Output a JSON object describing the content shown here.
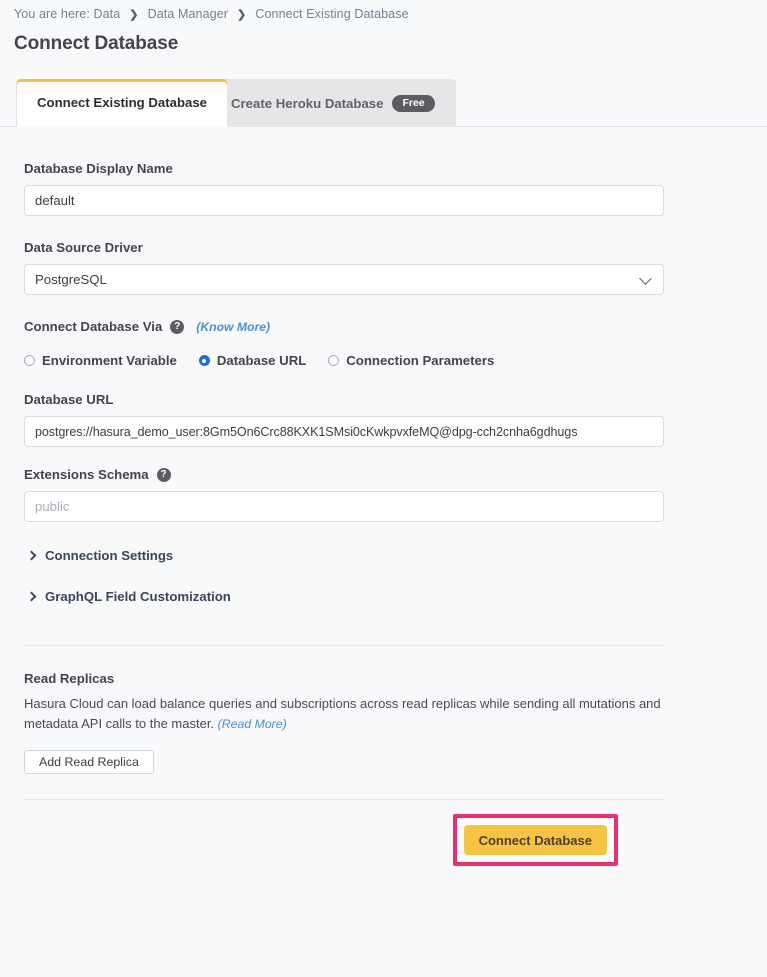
{
  "breadcrumb": {
    "prefix": "You are here: Data",
    "separator": "❯",
    "items": [
      {
        "label": "Data Manager"
      },
      {
        "label": "Connect Existing Database"
      }
    ]
  },
  "page_title": "Connect Database",
  "tabs": [
    {
      "label": "Connect Existing Database",
      "active": true,
      "badge": ""
    },
    {
      "label": "Create Heroku Database",
      "active": false,
      "badge": "Free"
    }
  ],
  "form": {
    "display_name": {
      "label": "Database Display Name",
      "value": "default",
      "placeholder": ""
    },
    "driver": {
      "label": "Data Source Driver",
      "value": "PostgreSQL",
      "options": [
        "PostgreSQL"
      ]
    },
    "connect_via": {
      "label": "Connect Database Via",
      "help_icon": "question-mark-icon",
      "know_more": "(Know More)",
      "options": [
        {
          "label": "Environment Variable",
          "selected": false
        },
        {
          "label": "Database URL",
          "selected": true
        },
        {
          "label": "Connection Parameters",
          "selected": false
        }
      ]
    },
    "database_url": {
      "label": "Database URL",
      "value": "postgres://hasura_demo_user:8Gm5On6Crc88KXK1SMsi0cKwkpvxfeMQ@dpg-cch2cnha6gdhugs"
    },
    "extensions_schema": {
      "label": "Extensions Schema",
      "help_icon": "question-mark-icon",
      "value": "",
      "placeholder": "public"
    },
    "collapsibles": [
      {
        "label": "Connection Settings",
        "icon": "chevron-right-icon"
      },
      {
        "label": "GraphQL Field Customization",
        "icon": "chevron-right-icon"
      }
    ]
  },
  "read_replicas": {
    "title": "Read Replicas",
    "description": "Hasura Cloud can load balance queries and subscriptions across read replicas while sending all mutations and metadata API calls to the master.",
    "read_more": "(Read More)",
    "add_button": "Add Read Replica"
  },
  "footer": {
    "submit_label": "Connect Database"
  },
  "colors": {
    "accent_yellow": "#f5c443",
    "highlight_pink": "#ec2f66",
    "radio_blue": "#1571e6",
    "link_blue": "#4b8fd4",
    "page_bg": "#f8f9fb"
  }
}
